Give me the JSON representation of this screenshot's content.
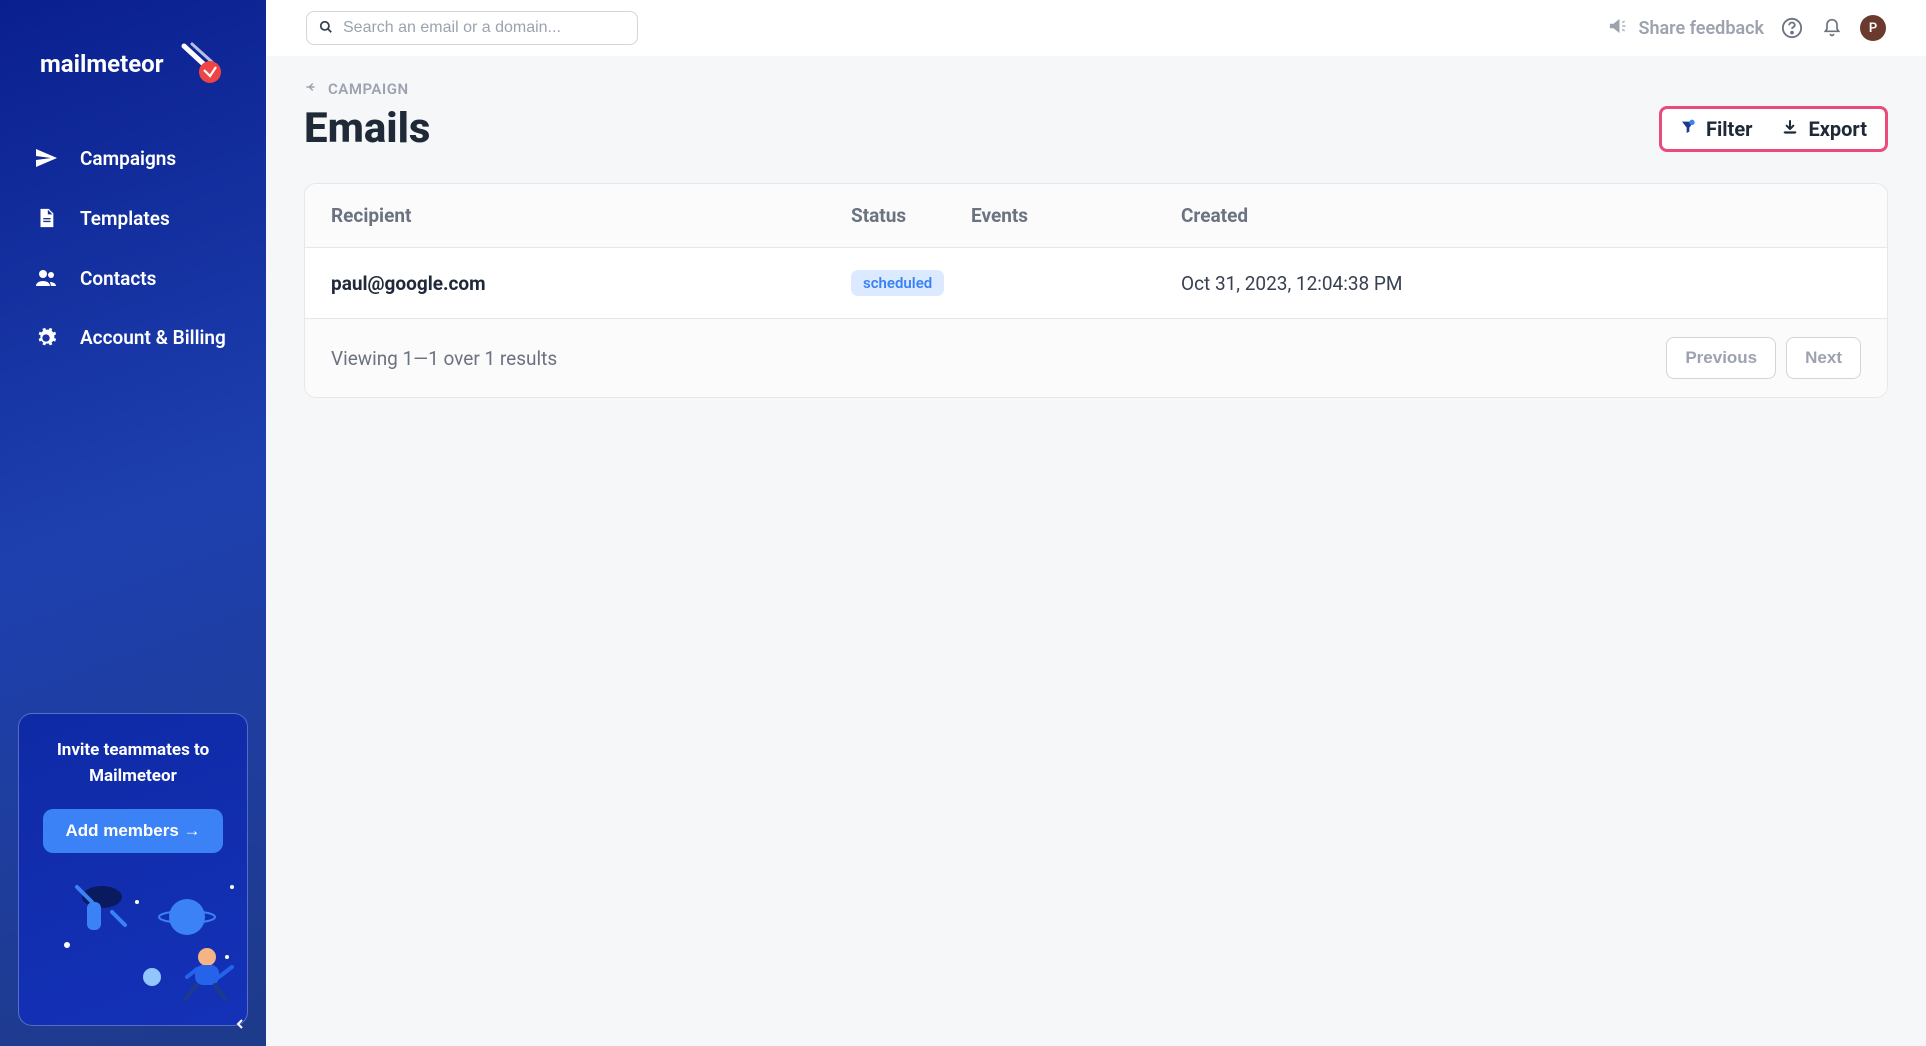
{
  "brand": {
    "name": "mailmeteor"
  },
  "sidebar": {
    "items": [
      {
        "label": "Campaigns"
      },
      {
        "label": "Templates"
      },
      {
        "label": "Contacts"
      },
      {
        "label": "Account & Billing"
      }
    ],
    "invite": {
      "title": "Invite teammates to Mailmeteor",
      "button": "Add members →"
    }
  },
  "topbar": {
    "search_placeholder": "Search an email or a domain...",
    "share_feedback": "Share feedback",
    "avatar_initial": "P"
  },
  "breadcrumb": {
    "label": "CAMPAIGN"
  },
  "page": {
    "title": "Emails"
  },
  "actions": {
    "filter": "Filter",
    "export": "Export"
  },
  "table": {
    "columns": {
      "recipient": "Recipient",
      "status": "Status",
      "events": "Events",
      "created": "Created"
    },
    "rows": [
      {
        "recipient": "paul@google.com",
        "status": "scheduled",
        "events": "",
        "created": "Oct 31, 2023, 12:04:38 PM"
      }
    ],
    "footer": {
      "results": "Viewing 1—1 over 1 results",
      "previous": "Previous",
      "next": "Next"
    }
  }
}
